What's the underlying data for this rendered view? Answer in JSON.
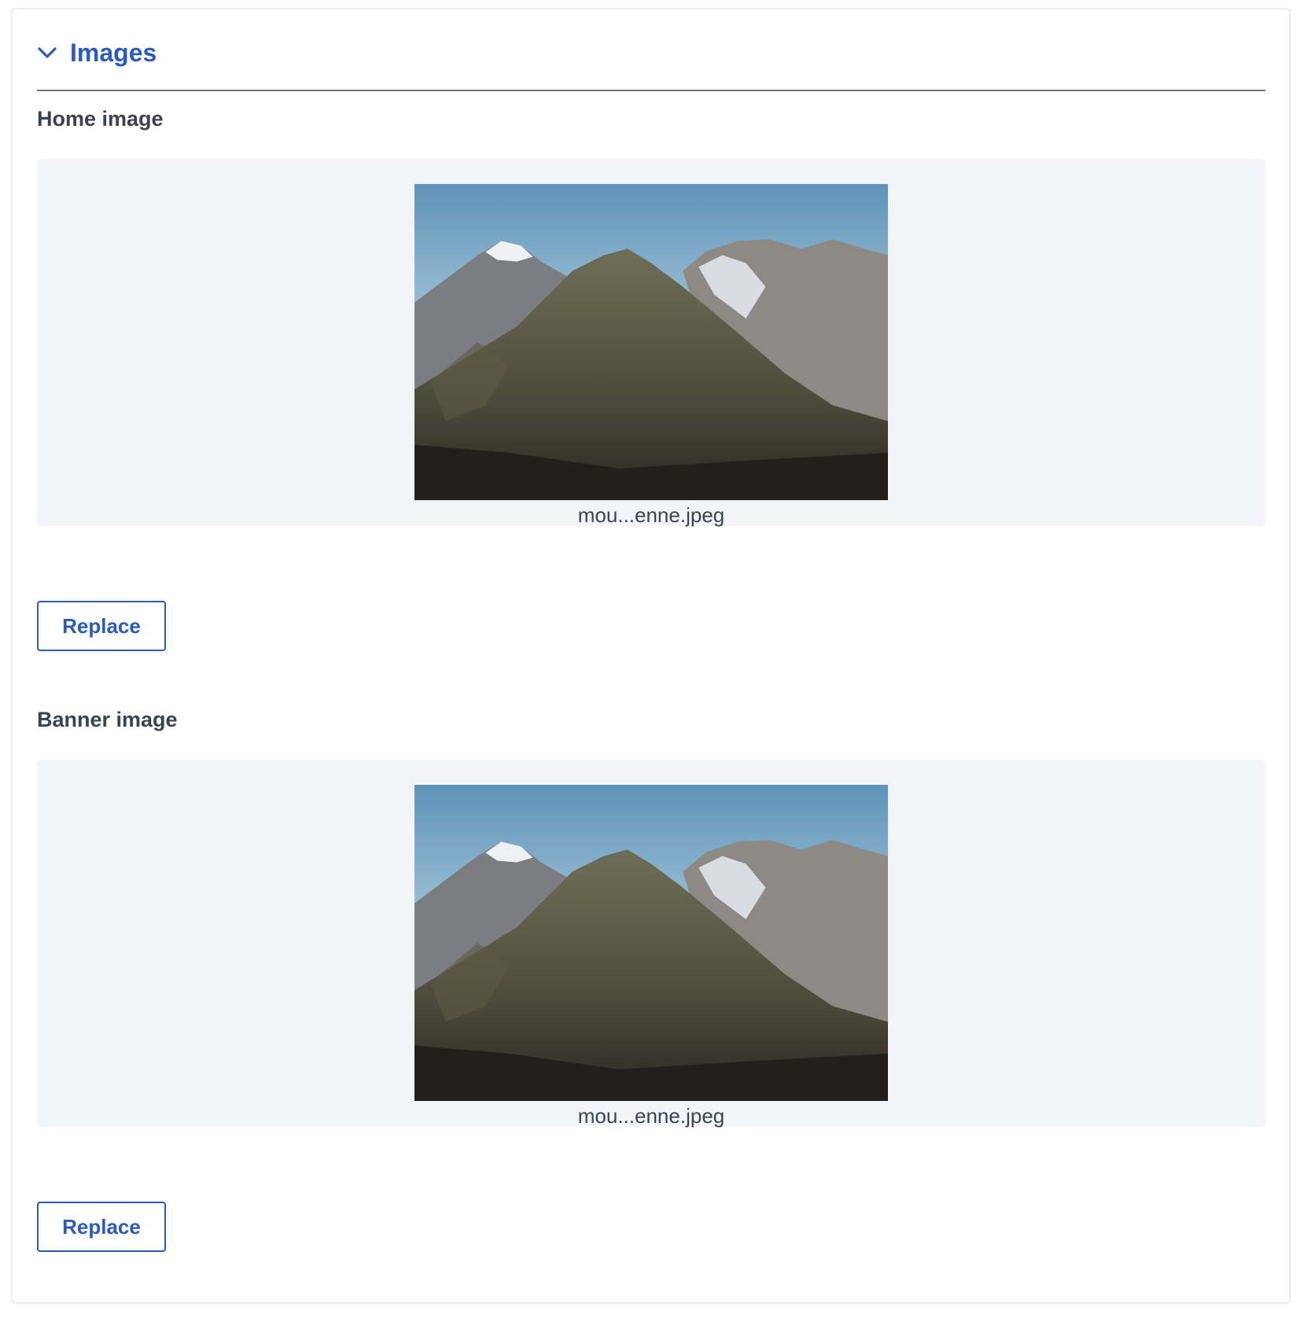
{
  "section": {
    "title": "Images",
    "icon": "chevron-down-icon",
    "accent_color": "#2a5bbd"
  },
  "home_image": {
    "label": "Home image",
    "filename": "mou...enne.jpeg",
    "replace_label": "Replace"
  },
  "banner_image": {
    "label": "Banner image",
    "filename": "mou...enne.jpeg",
    "replace_label": "Replace"
  }
}
